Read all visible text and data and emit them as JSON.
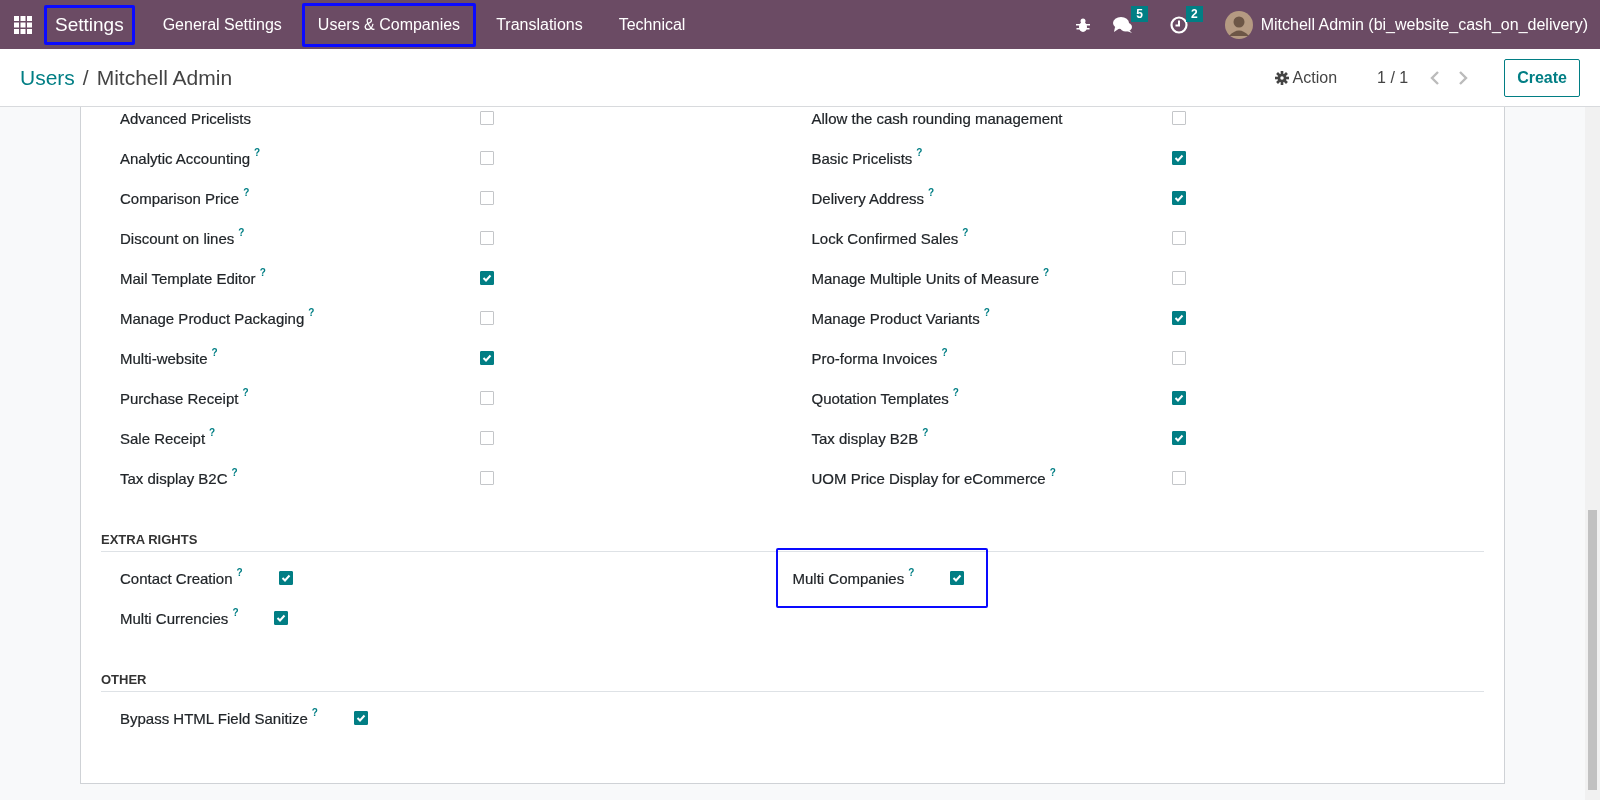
{
  "navbar": {
    "brand": {
      "label": "Settings",
      "highlighted": true
    },
    "menu": [
      {
        "label": "General Settings",
        "highlighted": false
      },
      {
        "label": "Users & Companies",
        "highlighted": true
      },
      {
        "label": "Translations",
        "highlighted": false
      },
      {
        "label": "Technical",
        "highlighted": false
      }
    ],
    "messages_count": "5",
    "activities_count": "2",
    "user": "Mitchell Admin (bi_website_cash_on_delivery)"
  },
  "breadcrumb": {
    "parent": "Users",
    "separator": "/",
    "current": "Mitchell Admin"
  },
  "control_panel": {
    "action": "Action",
    "pager": "1 / 1",
    "create": "Create"
  },
  "sections": [
    {
      "kind": "grid",
      "columns": [
        [
          {
            "label": "Advanced Pricelists",
            "checked": false
          },
          {
            "label": "Analytic Accounting",
            "help": "?",
            "checked": false
          },
          {
            "label": "Comparison Price",
            "help": "?",
            "checked": false
          },
          {
            "label": "Discount on lines",
            "help": "?",
            "checked": false
          },
          {
            "label": "Mail Template Editor",
            "help": "?",
            "checked": true
          },
          {
            "label": "Manage Product Packaging",
            "help": "?",
            "checked": false
          },
          {
            "label": "Multi-website",
            "help": "?",
            "checked": true
          },
          {
            "label": "Purchase Receipt",
            "help": "?",
            "checked": false
          },
          {
            "label": "Sale Receipt",
            "help": "?",
            "checked": false
          },
          {
            "label": "Tax display B2C",
            "help": "?",
            "checked": false
          }
        ],
        [
          {
            "label": "Allow the cash rounding management",
            "checked": false
          },
          {
            "label": "Basic Pricelists",
            "help": "?",
            "checked": true
          },
          {
            "label": "Delivery Address",
            "help": "?",
            "checked": true
          },
          {
            "label": "Lock Confirmed Sales",
            "help": "?",
            "checked": false
          },
          {
            "label": "Manage Multiple Units of Measure",
            "help": "?",
            "checked": false
          },
          {
            "label": "Manage Product Variants",
            "help": "?",
            "checked": true
          },
          {
            "label": "Pro-forma Invoices",
            "help": "?",
            "checked": false
          },
          {
            "label": "Quotation Templates",
            "help": "?",
            "checked": true
          },
          {
            "label": "Tax display B2B",
            "help": "?",
            "checked": true
          },
          {
            "label": "UOM Price Display for eCommerce",
            "help": "?",
            "checked": false
          }
        ]
      ]
    },
    {
      "kind": "inline",
      "title": "EXTRA RIGHTS",
      "columns": [
        [
          {
            "label": "Contact Creation",
            "help": "?",
            "checked": true,
            "highlighted": false
          },
          {
            "label": "Multi Currencies",
            "help": "?",
            "checked": true,
            "highlighted": false
          }
        ],
        [
          {
            "label": "Multi Companies",
            "help": "?",
            "checked": true,
            "highlighted": true
          }
        ]
      ]
    },
    {
      "kind": "inline",
      "title": "OTHER",
      "columns": [
        [
          {
            "label": "Bypass HTML Field Sanitize",
            "help": "?",
            "checked": true,
            "highlighted": false
          }
        ]
      ]
    }
  ]
}
